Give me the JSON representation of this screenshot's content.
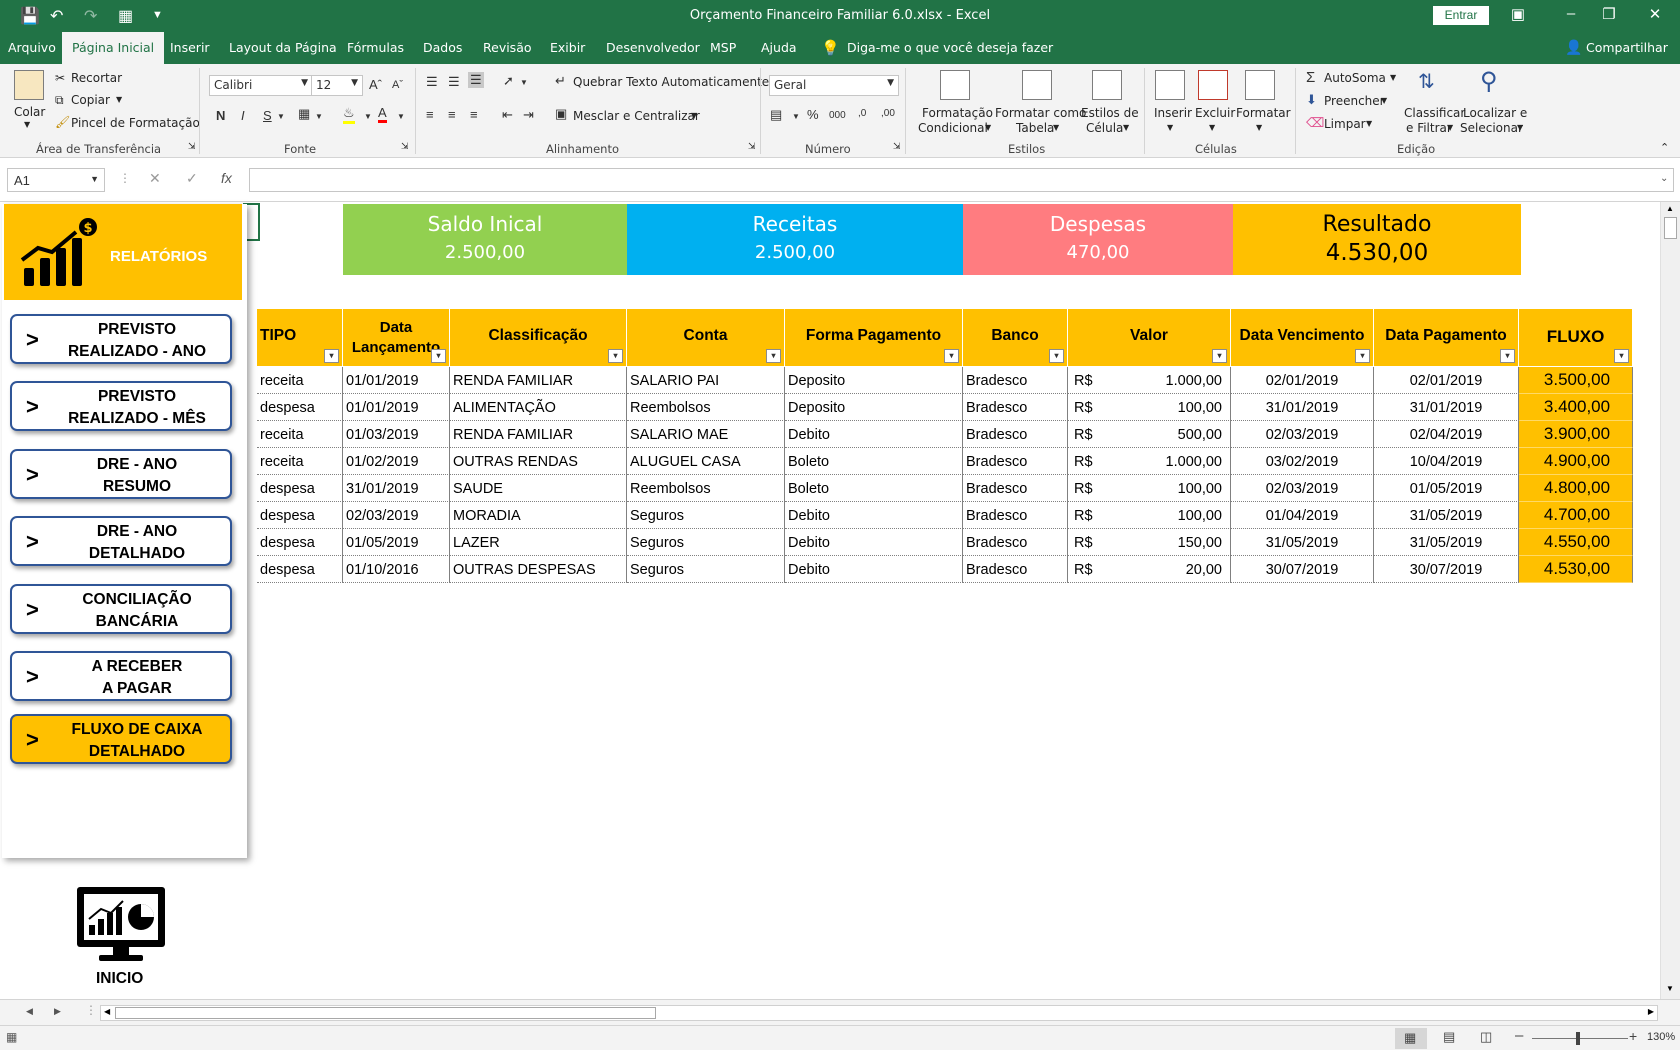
{
  "window": {
    "title": "Orçamento Financeiro Familiar 6.0.xlsx  -  Excel",
    "signin": "Entrar"
  },
  "tabs": [
    "Arquivo",
    "Página Inicial",
    "Inserir",
    "Layout da Página",
    "Fórmulas",
    "Dados",
    "Revisão",
    "Exibir",
    "Desenvolvedor",
    "MSP",
    "Ajuda",
    "Diga-me o que você deseja fazer",
    "Compartilhar"
  ],
  "ribbon": {
    "clipboard": {
      "paste": "Colar",
      "cut": "Recortar",
      "copy": "Copiar",
      "painter": "Pincel de Formatação",
      "group": "Área de Transferência"
    },
    "font": {
      "name": "Calibri",
      "size": "12",
      "group": "Fonte",
      "bold": "N",
      "italic": "I",
      "underline": "S"
    },
    "alignment": {
      "wrap": "Quebrar Texto Automaticamente",
      "merge": "Mesclar e Centralizar",
      "group": "Alinhamento"
    },
    "number": {
      "format": "Geral",
      "group": "Número"
    },
    "styles": {
      "conditional_1": "Formatação",
      "conditional_2": "Condicional",
      "table_1": "Formatar como",
      "table_2": "Tabela",
      "cell_1": "Estilos de",
      "cell_2": "Célula",
      "group": "Estilos"
    },
    "cells": {
      "insert": "Inserir",
      "delete": "Excluir",
      "format": "Formatar",
      "group": "Células"
    },
    "editing": {
      "autosum": "AutoSoma",
      "fill": "Preencher",
      "clear": "Limpar",
      "sort_1": "Classificar",
      "sort_2": "e Filtrar",
      "find_1": "Localizar e",
      "find_2": "Selecionar",
      "group": "Edição"
    }
  },
  "formula_bar": {
    "name_box": "A1",
    "fx": "fx",
    "content": ""
  },
  "panel": {
    "header": "RELATÓRIOS",
    "buttons": [
      {
        "label": "PREVISTO\nREALIZADO - ANO",
        "active": false
      },
      {
        "label": "PREVISTO\nREALIZADO - MÊS",
        "active": false
      },
      {
        "label": "DRE - ANO\nRESUMO",
        "active": false
      },
      {
        "label": "DRE - ANO\nDETALHADO",
        "active": false
      },
      {
        "label": "CONCILIAÇÃO\nBANCÁRIA",
        "active": false
      },
      {
        "label": "A RECEBER\nA PAGAR",
        "active": false
      },
      {
        "label": "FLUXO DE CAIXA\nDETALHADO",
        "active": true
      }
    ],
    "home_label": "INICIO"
  },
  "summary": [
    {
      "title": "Saldo Inical",
      "value": "2.500,00",
      "color": "#92d050"
    },
    {
      "title": "Receitas",
      "value": "2.500,00",
      "color": "#00b0f0"
    },
    {
      "title": "Despesas",
      "value": "470,00",
      "color": "#ff7c80"
    },
    {
      "title": "Resultado",
      "value": "4.530,00",
      "color": "#ffc000"
    }
  ],
  "table": {
    "columns": [
      "TIPO",
      "Data Lançamento",
      "Classificação",
      "Conta",
      "Forma Pagamento",
      "Banco",
      "Valor",
      "Data Vencimento",
      "Data  Pagamento",
      "FLUXO"
    ],
    "currency": "R$",
    "rows": [
      [
        "receita",
        "01/01/2019",
        "RENDA FAMILIAR",
        "SALARIO PAI",
        "Deposito",
        "Bradesco",
        "1.000,00",
        "02/01/2019",
        "02/01/2019",
        "3.500,00"
      ],
      [
        "despesa",
        "01/01/2019",
        "ALIMENTAÇÃO",
        "Reembolsos",
        "Deposito",
        "Bradesco",
        "100,00",
        "31/01/2019",
        "31/01/2019",
        "3.400,00"
      ],
      [
        "receita",
        "01/03/2019",
        "RENDA FAMILIAR",
        "SALARIO MAE",
        "Debito",
        "Bradesco",
        "500,00",
        "02/03/2019",
        "02/04/2019",
        "3.900,00"
      ],
      [
        "receita",
        "01/02/2019",
        "OUTRAS RENDAS",
        "ALUGUEL CASA",
        "Boleto",
        "Bradesco",
        "1.000,00",
        "03/02/2019",
        "10/04/2019",
        "4.900,00"
      ],
      [
        "despesa",
        "31/01/2019",
        "SAUDE",
        "Reembolsos",
        "Boleto",
        "Bradesco",
        "100,00",
        "02/03/2019",
        "01/05/2019",
        "4.800,00"
      ],
      [
        "despesa",
        "02/03/2019",
        "MORADIA",
        "Seguros",
        "Debito",
        "Bradesco",
        "100,00",
        "01/04/2019",
        "31/05/2019",
        "4.700,00"
      ],
      [
        "despesa",
        "01/05/2019",
        "LAZER",
        "Seguros",
        "Debito",
        "Bradesco",
        "150,00",
        "31/05/2019",
        "31/05/2019",
        "4.550,00"
      ],
      [
        "despesa",
        "01/10/2016",
        "OUTRAS DESPESAS",
        "Seguros",
        "Debito",
        "Bradesco",
        "20,00",
        "30/07/2019",
        "30/07/2019",
        "4.530,00"
      ]
    ]
  },
  "status": {
    "zoom": "130%"
  }
}
